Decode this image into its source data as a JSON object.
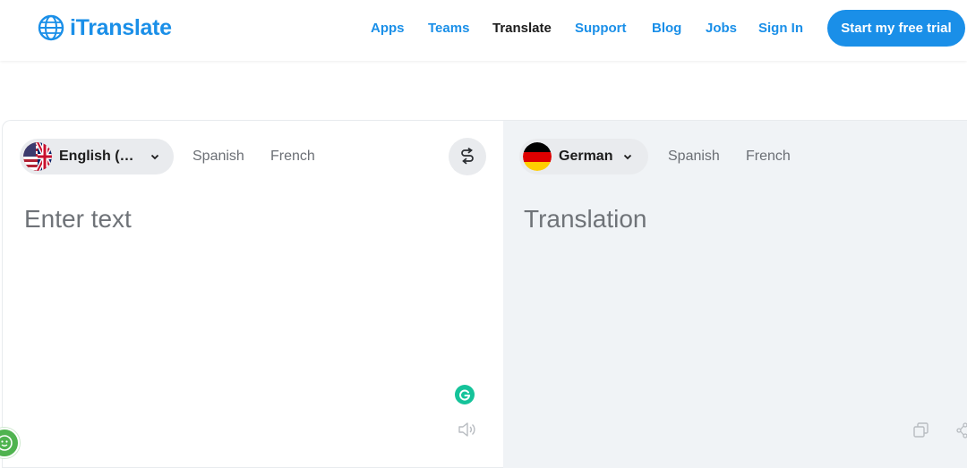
{
  "brand": {
    "name": "iTranslate",
    "color": "#1a8fe8"
  },
  "nav": {
    "items": [
      {
        "label": "Apps",
        "active": false
      },
      {
        "label": "Teams",
        "active": false
      },
      {
        "label": "Translate",
        "active": true
      },
      {
        "label": "Support",
        "active": false
      },
      {
        "label": "Blog",
        "active": false
      },
      {
        "label": "Jobs",
        "active": false
      },
      {
        "label": "Sign In",
        "active": false
      }
    ],
    "cta_label": "Start my free trial"
  },
  "source": {
    "selected_language": "English (…",
    "flag_icon": "us-uk-flag-icon",
    "options": [
      "Spanish",
      "French"
    ],
    "placeholder": "Enter text",
    "swap_icon": "swap-icon",
    "grammarly_icon": "grammarly-icon",
    "speaker_icon": "speaker-icon"
  },
  "target": {
    "selected_language": "German",
    "flag_icon": "germany-flag-icon",
    "options": [
      "Spanish",
      "French"
    ],
    "placeholder": "Translation",
    "copy_icon": "copy-icon",
    "share_icon": "share-icon"
  },
  "colors": {
    "panel_right_bg": "#f0f3f6",
    "pill_bg": "#e9ebee",
    "grammarly": "#15c39a",
    "chat_bubble": "#4fb34f"
  }
}
